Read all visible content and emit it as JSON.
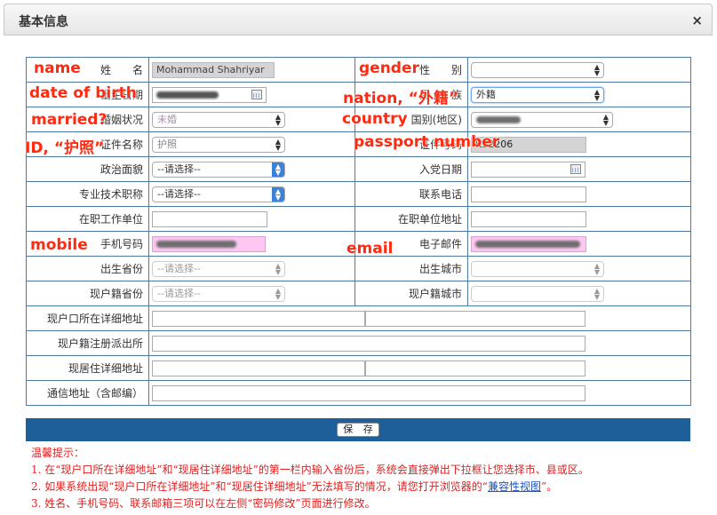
{
  "dialog": {
    "title": "基本信息",
    "close_glyph": "×"
  },
  "form": {
    "name_label": "姓　　名",
    "name_value": "Mohammad Shahriyar",
    "gender_label": "性　　别",
    "birth_label": "出生日期",
    "nation_label": "民　　族",
    "nation_value": "外籍",
    "marital_label": "婚姻状况",
    "marital_value": "未婚",
    "country_label": "国别(地区)",
    "id_type_label": "证件名称",
    "id_type_value": "护照",
    "id_number_label": "证件号码",
    "id_number_value": "K92206",
    "political_label": "政治面貌",
    "party_date_label": "入党日期",
    "title_label": "专业技术职称",
    "phone_label": "联系电话",
    "employer_label": "在职工作单位",
    "employer_addr_label": "在职单位地址",
    "mobile_label": "手机号码",
    "email_label": "电子邮件",
    "birth_province_label": "出生省份",
    "birth_city_label": "出生城市",
    "reg_province_label": "现户籍省份",
    "reg_city_label": "现户籍城市",
    "reg_addr_label": "现户口所在详细地址",
    "police_station_label": "现户籍注册派出所",
    "residence_addr_label": "现居住详细地址",
    "mail_addr_label": "通信地址（含邮编）",
    "select_placeholder": "--请选择--",
    "save_label": "保 存"
  },
  "tips": {
    "heading": "温馨提示：",
    "line1": "1. 在“现户口所在详细地址”和“现居住详细地址”的第一栏内输入省份后，系统会直接弹出下拉框让您选择市、县或区。",
    "line2_pre": "2. 如果系统出现“现户口所在详细地址”和“现居住详细地址”无法填写的情况，请您打开浏览器的“",
    "line2_link": "兼容性视图",
    "line2_post": "”。",
    "line3": "3. 姓名、手机号码、联系邮箱三项可以在左侧“密码修改”页面进行修改。"
  },
  "annotations": {
    "name": "name",
    "gender": "gender",
    "birth": "date of birth",
    "nation": "nation, “外籍”",
    "married": "married?",
    "country": "country",
    "id": "ID, “护照”",
    "passport": "passport number",
    "mobile": "mobile",
    "email": "email"
  },
  "icons": {
    "close": "close-icon",
    "calendar": "calendar-icon",
    "select_arrow": "updown-arrow-icon"
  },
  "colors": {
    "table_border": "#4d7aa3",
    "button_bar": "#1f5f99",
    "highlight_pink": "#fcc8f2",
    "annotation_red": "#ff2a10",
    "tips_red": "#e02020"
  }
}
